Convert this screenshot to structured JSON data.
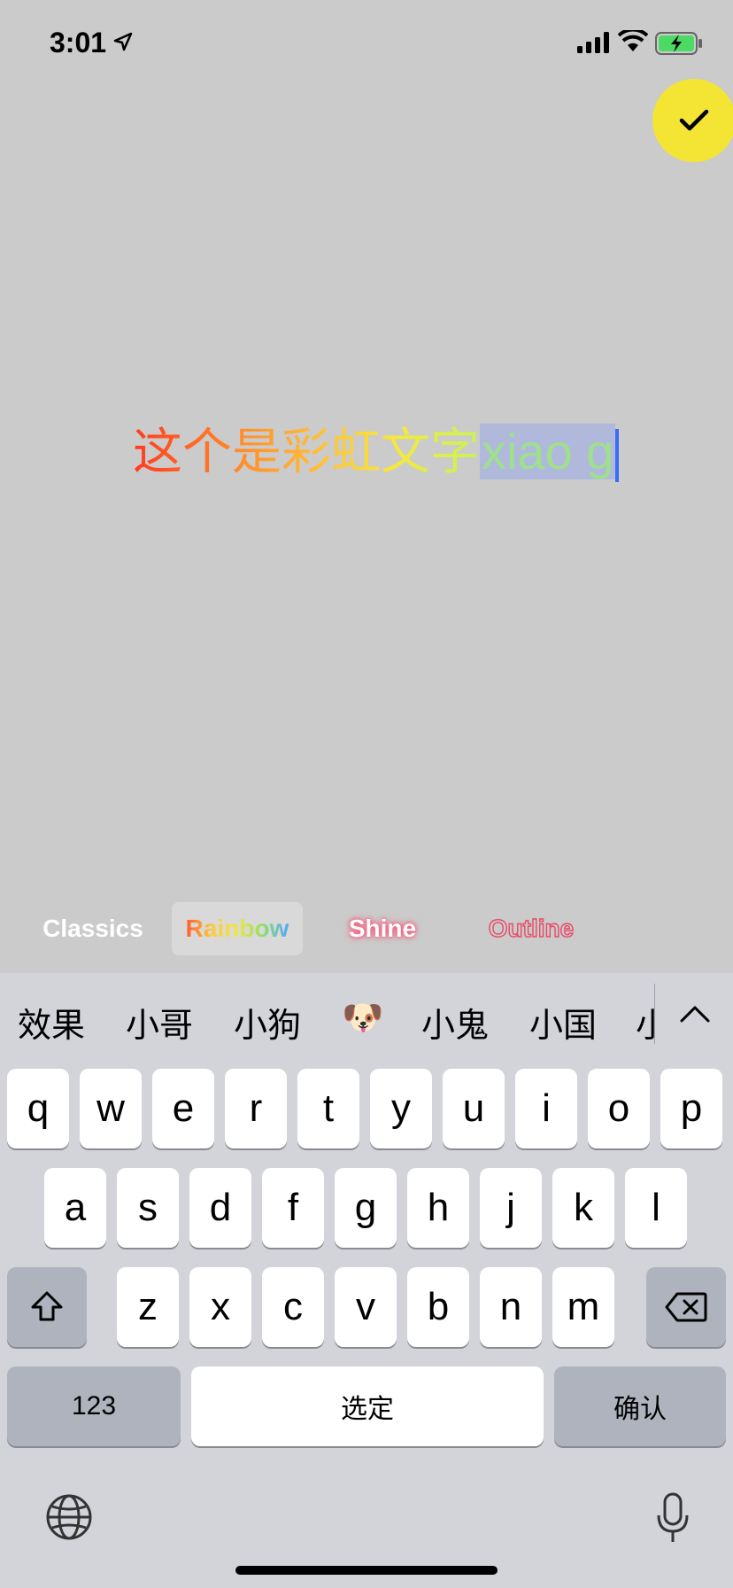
{
  "status": {
    "time": "3:01"
  },
  "editor": {
    "chinese_text": "这个是彩虹文字",
    "selected_text": "xiao g"
  },
  "styles": [
    "Classics",
    "Rainbow",
    "Shine",
    "Outline"
  ],
  "keyboard": {
    "candidates": [
      "效果",
      "小哥",
      "小狗",
      "🐶",
      "小鬼",
      "小国",
      "小"
    ],
    "row1": [
      "q",
      "w",
      "e",
      "r",
      "t",
      "y",
      "u",
      "i",
      "o",
      "p"
    ],
    "row2": [
      "a",
      "s",
      "d",
      "f",
      "g",
      "h",
      "j",
      "k",
      "l"
    ],
    "row3": [
      "z",
      "x",
      "c",
      "v",
      "b",
      "n",
      "m"
    ],
    "numbers_label": "123",
    "space_label": "选定",
    "return_label": "确认"
  },
  "icons": {
    "location": "location-arrow-icon",
    "signal": "cellular-signal-icon",
    "wifi": "wifi-icon",
    "battery": "battery-charging-icon",
    "done": "checkmark-icon",
    "expand": "chevron-up-icon",
    "shift": "shift-icon",
    "delete": "backspace-icon",
    "globe": "globe-icon",
    "mic": "microphone-icon"
  },
  "colors": {
    "done_button": "#f4e433",
    "caret": "#3b6cf5",
    "selection": "#b0b9dc"
  }
}
